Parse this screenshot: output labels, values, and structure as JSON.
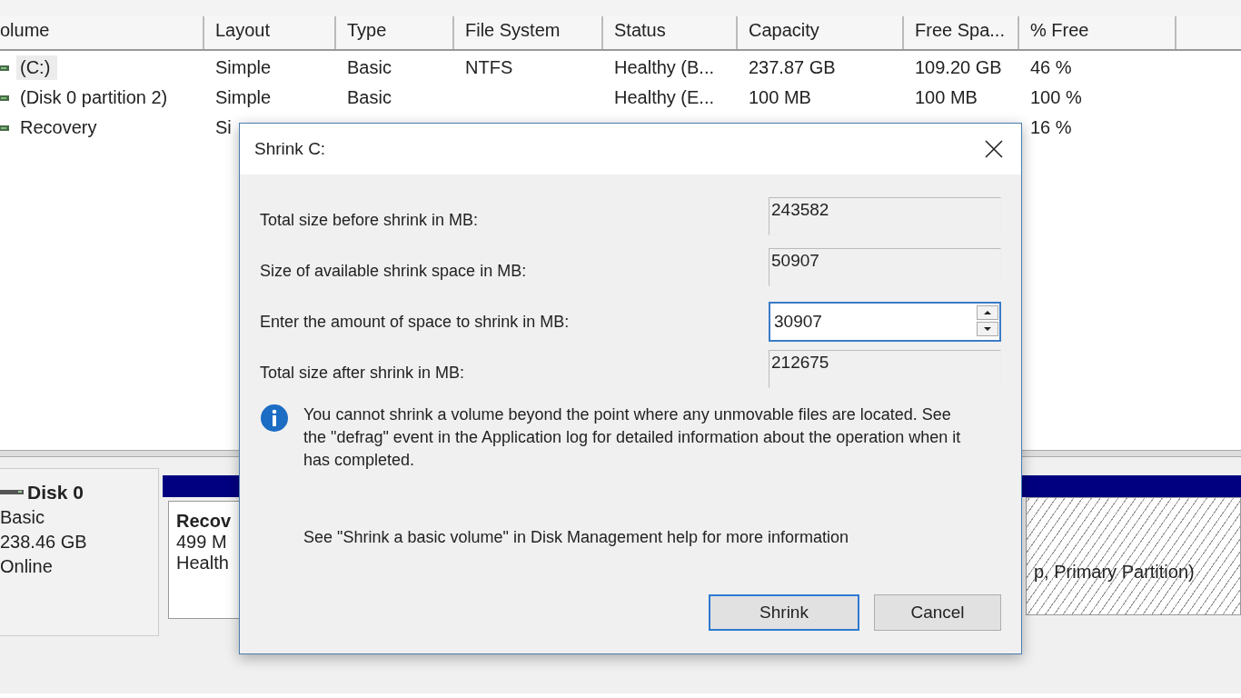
{
  "volume_list": {
    "columns": [
      "olume",
      "Layout",
      "Type",
      "File System",
      "Status",
      "Capacity",
      "Free Spa...",
      "% Free"
    ],
    "rows": [
      {
        "volume": "(C:)",
        "layout": "Simple",
        "type": "Basic",
        "file_system": "NTFS",
        "status": "Healthy (B...",
        "capacity": "237.87 GB",
        "free_space": "109.20 GB",
        "percent_free": "46 %",
        "selected": true
      },
      {
        "volume": "(Disk 0 partition 2)",
        "layout": "Simple",
        "type": "Basic",
        "status": "Healthy (E...",
        "capacity": "100 MB",
        "free_space": "100 MB",
        "percent_free": "100 %",
        "selected": false
      },
      {
        "volume": "Recovery",
        "layout": "Si",
        "percent_free": "16 %",
        "selected": false
      }
    ]
  },
  "disk": {
    "name": "Disk 0",
    "type": "Basic",
    "size": "238.46 GB",
    "status": "Online"
  },
  "partitions": [
    {
      "name": "Recov",
      "size": "499 M",
      "status": "Health",
      "selected": false
    },
    {
      "status": "p, Primary Partition)",
      "selected": true
    }
  ],
  "dialog": {
    "title": "Shrink C:",
    "fields": [
      {
        "label": "Total size before shrink in MB:",
        "value": "243582",
        "kind": "readonly"
      },
      {
        "label": "Size of available shrink space in MB:",
        "value": "50907",
        "kind": "readonly"
      },
      {
        "label": "Enter the amount of space to shrink in MB:",
        "value": "30907",
        "kind": "spin"
      },
      {
        "label": "Total size after shrink in MB:",
        "value": "212675",
        "kind": "readonly"
      }
    ],
    "info": "You cannot shrink a volume beyond the point where any unmovable files are located. See the \"defrag\" event in the Application log for detailed information about the operation when it has completed.",
    "help": "See \"Shrink a basic volume\" in Disk Management help for more information",
    "buttons": [
      {
        "label": "Shrink",
        "default": true
      },
      {
        "label": "Cancel",
        "default": false
      }
    ]
  }
}
